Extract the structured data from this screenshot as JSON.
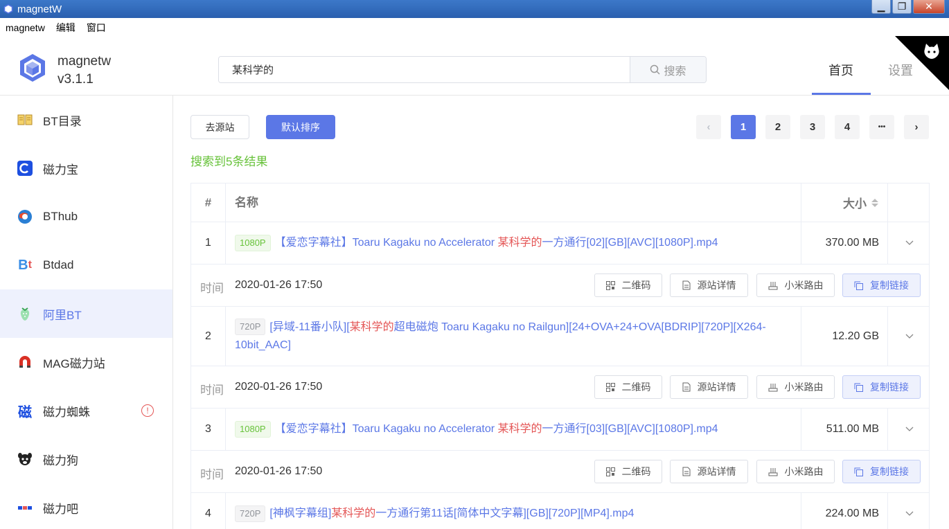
{
  "window": {
    "title": "magnetW",
    "minimize": "▁",
    "restore": "❐",
    "close": "✕"
  },
  "menu": [
    "magnetw",
    "编辑",
    "窗口"
  ],
  "brand": {
    "name": "magnetw",
    "version": "v3.1.1"
  },
  "search": {
    "value": "某科学的",
    "button": "搜索"
  },
  "nav": {
    "home": "首页",
    "settings": "设置"
  },
  "sidebar": [
    {
      "label": "BT目录",
      "icon": "book-icon"
    },
    {
      "label": "磁力宝",
      "icon": "c-logo-icon"
    },
    {
      "label": "BThub",
      "icon": "globe-icon"
    },
    {
      "label": "Btdad",
      "icon": "bt-logo-icon"
    },
    {
      "label": "阿里BT",
      "icon": "strawberry-icon",
      "active": true
    },
    {
      "label": "MAG磁力站",
      "icon": "magnet-icon"
    },
    {
      "label": "磁力蜘蛛",
      "icon": "ci-logo-icon",
      "warning": "!"
    },
    {
      "label": "磁力狗",
      "icon": "dog-icon"
    },
    {
      "label": "磁力吧",
      "icon": "tne-logo-icon"
    }
  ],
  "toolbar": {
    "source": "去源站",
    "sort": "默认排序"
  },
  "pagination": {
    "prev": "‹",
    "pages": [
      "1",
      "2",
      "3",
      "4"
    ],
    "more": "•••",
    "next": "›",
    "current": "1"
  },
  "result_count": "搜索到5条结果",
  "table": {
    "headers": {
      "index": "#",
      "name": "名称",
      "size": "大小"
    },
    "time_label": "时间",
    "actions": {
      "qr": "二维码",
      "detail": "源站详情",
      "router": "小米路由",
      "copy": "复制链接"
    },
    "rows": [
      {
        "index": "1",
        "tag": "1080P",
        "tag_type": "hd",
        "pre": "【爱恋字幕社】Toaru Kagaku no Accelerator ",
        "hl": "某科学的",
        "post": "一方通行[02][GB][AVC][1080P].mp4",
        "size": "370.00 MB",
        "time": "2020-01-26 17:50"
      },
      {
        "index": "2",
        "tag": "720P",
        "tag_type": "sd",
        "pre": "[异域-11番小队][",
        "hl": "某科学的",
        "post": "超电磁炮 Toaru Kagaku no Railgun][24+OVA+24+OVA[BDRIP][720P][X264-10bit_AAC]",
        "size": "12.20 GB",
        "time": "2020-01-26 17:50"
      },
      {
        "index": "3",
        "tag": "1080P",
        "tag_type": "hd",
        "pre": "【爱恋字幕社】Toaru Kagaku no Accelerator ",
        "hl": "某科学的",
        "post": "一方通行[03][GB][AVC][1080P].mp4",
        "size": "511.00 MB",
        "time": "2020-01-26 17:50"
      },
      {
        "index": "4",
        "tag": "720P",
        "tag_type": "sd",
        "pre": "[神枫字幕组]",
        "hl": "某科学的",
        "post": "一方通行第11话[简体中文字幕][GB][720P][MP4].mp4",
        "size": "224.00 MB",
        "time": ""
      }
    ]
  },
  "colors": {
    "accent": "#5b77e6",
    "success": "#67c23a",
    "highlight": "#e45656"
  }
}
